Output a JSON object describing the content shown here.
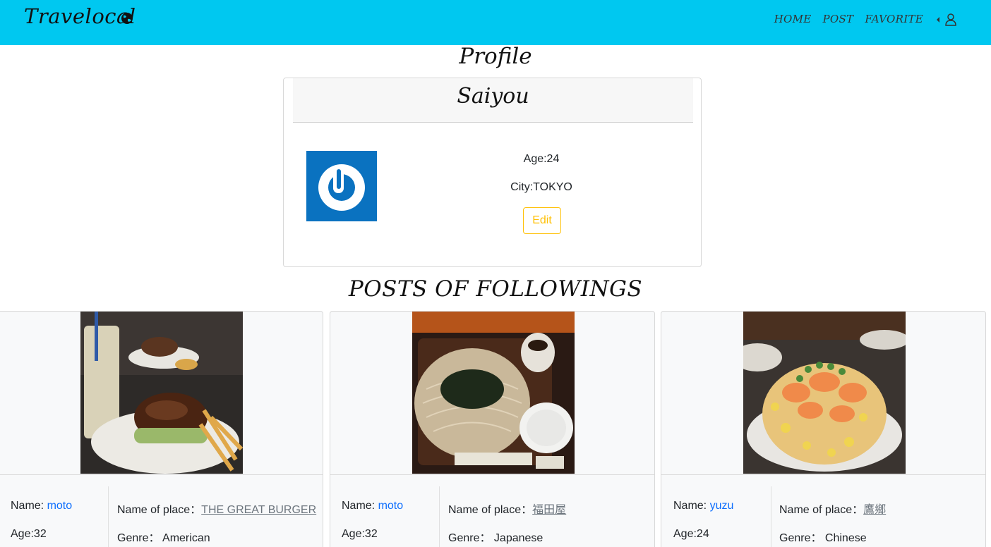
{
  "navbar": {
    "brand": "Travelocal",
    "links": [
      "HOME",
      "POST",
      "FAVORITE"
    ],
    "bg_color": "#00c8f0"
  },
  "page_title": "Profile",
  "profile": {
    "name": "Saiyou",
    "age": "Age:24",
    "city": "City:TOKYO",
    "edit_label": "Edit",
    "edit_color": "#ffc107"
  },
  "section_title": "POSTS OF FOLLOWINGS",
  "posts": [
    {
      "name_label": "Name: ",
      "user": "moto",
      "age": "Age:32",
      "place_label": "Name of place：",
      "place": "THE GREAT BURGER",
      "genre": "Genre： American",
      "photo": "burger-photo"
    },
    {
      "name_label": "Name: ",
      "user": "moto",
      "age": "Age:32",
      "place_label": "Name of place：",
      "place": "福田屋",
      "genre": "Genre： Japanese",
      "photo": "soba-photo"
    },
    {
      "name_label": "Name: ",
      "user": "yuzu",
      "age": "Age:24",
      "place_label": "Name of place：",
      "place": "鷹鄉",
      "genre": "Genre： Chinese",
      "photo": "shrimp-fried-rice-photo"
    }
  ]
}
